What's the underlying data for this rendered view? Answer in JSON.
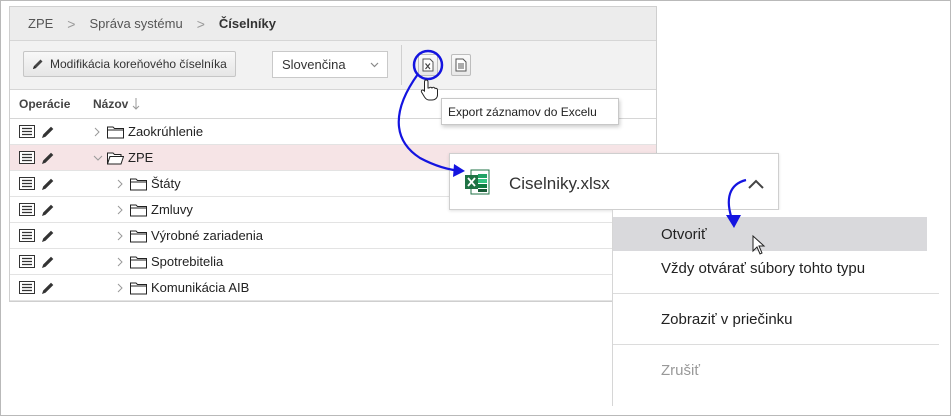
{
  "breadcrumb": {
    "items": [
      "ZPE",
      "Správa systému",
      "Číselníky"
    ],
    "separator": ">"
  },
  "toolbar": {
    "modify_label": "Modifikácia koreňového číselníka",
    "language_value": "Slovenčina"
  },
  "table": {
    "columns": [
      "Operácie",
      "Názov"
    ],
    "rows": [
      {
        "label": "Zaokrúhlenie",
        "level": 0,
        "expanded": false,
        "selected": false
      },
      {
        "label": "ZPE",
        "level": 0,
        "expanded": true,
        "selected": true
      },
      {
        "label": "Štáty",
        "level": 1,
        "expanded": false,
        "selected": false
      },
      {
        "label": "Zmluvy",
        "level": 1,
        "expanded": false,
        "selected": false
      },
      {
        "label": "Výrobné zariadenia",
        "level": 1,
        "expanded": false,
        "selected": false
      },
      {
        "label": "Spotrebitelia",
        "level": 1,
        "expanded": false,
        "selected": false
      },
      {
        "label": "Komunikácia AIB",
        "level": 1,
        "expanded": false,
        "selected": false
      }
    ]
  },
  "tooltip": {
    "text": "Export záznamov do Excelu"
  },
  "download": {
    "filename": "Ciselniky.xlsx"
  },
  "menu": {
    "items": [
      "Otvoriť",
      "Vždy otvárať súbory tohto typu",
      "Zobraziť v priečinku",
      "Zrušiť"
    ],
    "highlighted": "Otvoriť",
    "disabled": "Zrušiť"
  },
  "colors": {
    "accent_annotation": "#1414e0",
    "selected_row": "#f6e4e6",
    "excel_green": "#1f7244"
  },
  "icons": {
    "list": "list-icon",
    "edit": "pencil-icon",
    "folder": "folder-icon",
    "excel_export": "excel-export-icon",
    "report": "report-icon",
    "sort": "sort-down-arrow-icon",
    "excel_file": "excel-file-icon"
  }
}
